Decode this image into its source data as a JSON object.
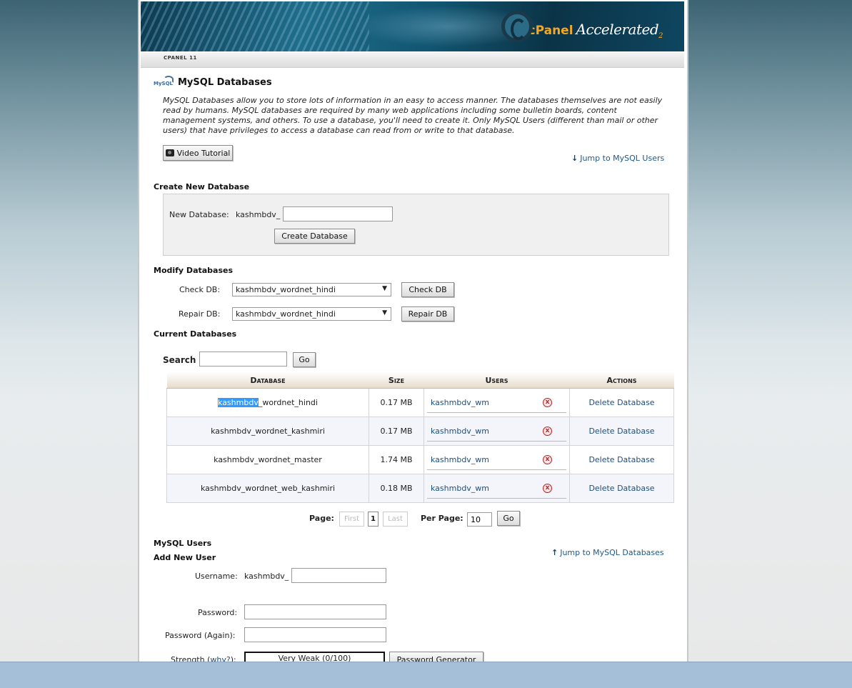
{
  "header": {
    "product": "cPanel",
    "product_suffix": "Accelerated",
    "version_sub": "2",
    "breadcrumb": "CPANEL 11"
  },
  "page": {
    "icon_text": "MySQL",
    "title": "MySQL Databases",
    "description": "MySQL Databases allow you to store lots of information in an easy to access manner. The databases themselves are not easily read by humans. MySQL databases are required by many web applications including some bulletin boards, content management systems, and others. To use a database, you'll need to create it. Only MySQL Users (different than mail or other users) that have privileges to access a database can read from or write to that database.",
    "video_tutorial": "Video Tutorial",
    "jump_users": "Jump to MySQL Users",
    "jump_databases": "Jump to MySQL Databases"
  },
  "create": {
    "heading": "Create New Database",
    "label": "New Database:",
    "prefix": "kashmbdv_",
    "value": "",
    "button": "Create Database"
  },
  "modify": {
    "heading": "Modify Databases",
    "check_label": "Check DB:",
    "check_selected": "kashmbdv_wordnet_hindi",
    "check_button": "Check DB",
    "repair_label": "Repair DB:",
    "repair_selected": "kashmbdv_wordnet_hindi",
    "repair_button": "Repair DB"
  },
  "current": {
    "heading": "Current Databases",
    "search_label": "Search",
    "search_value": "",
    "go": "Go",
    "columns": [
      "Database",
      "Size",
      "Users",
      "Actions"
    ],
    "rows": [
      {
        "db_highlight": "kashmbdv",
        "db_rest": "_wordnet_hindi",
        "size": "0.17 MB",
        "user": "kashmbdv_wm",
        "action": "Delete Database"
      },
      {
        "db": "kashmbdv_wordnet_kashmiri",
        "size": "0.17 MB",
        "user": "kashmbdv_wm",
        "action": "Delete Database"
      },
      {
        "db": "kashmbdv_wordnet_master",
        "size": "1.74 MB",
        "user": "kashmbdv_wm",
        "action": "Delete Database"
      },
      {
        "db": "kashmbdv_wordnet_web_kashmiri",
        "size": "0.18 MB",
        "user": "kashmbdv_wm",
        "action": "Delete Database"
      }
    ],
    "remove_glyph": "x"
  },
  "pagination": {
    "page_label": "Page:",
    "first": "First",
    "current": "1",
    "last": "Last",
    "per_page_label": "Per Page:",
    "per_page_value": "10",
    "go": "Go"
  },
  "users": {
    "heading": "MySQL Users",
    "subheading": "Add New User",
    "username_label": "Username:",
    "username_prefix": "kashmbdv_",
    "password_label": "Password:",
    "password_again_label": "Password (Again):",
    "strength_label": "Strength",
    "strength_why": "why?",
    "strength_value": "Very Weak (0/100)",
    "password_generator": "Password Generator"
  }
}
